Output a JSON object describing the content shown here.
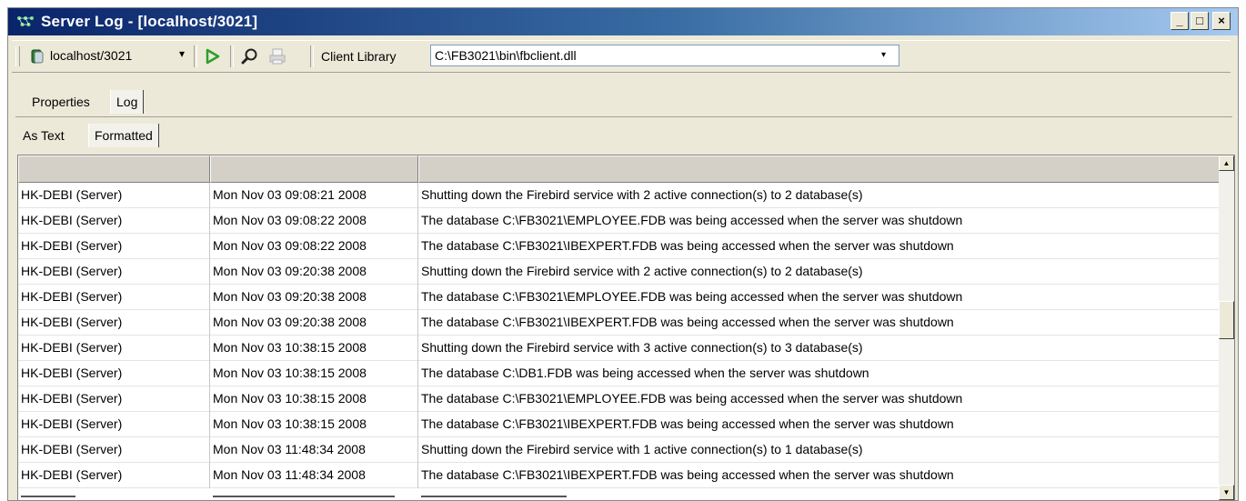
{
  "window": {
    "title": "Server Log - [localhost/3021]",
    "minimize_glyph": "_",
    "maximize_glyph": "□",
    "close_glyph": "×"
  },
  "toolbar": {
    "server_label": "localhost/3021",
    "client_library_label": "Client Library",
    "client_library_value": "C:\\FB3021\\bin\\fbclient.dll",
    "dropdown_arrow": "▾"
  },
  "tabs": [
    {
      "label": "Properties",
      "active": false
    },
    {
      "label": "Log",
      "active": true
    }
  ],
  "view_tabs": [
    {
      "label": "As Text",
      "active": false
    },
    {
      "label": "Formatted",
      "active": true
    }
  ],
  "columns": [
    "",
    "",
    ""
  ],
  "rows": [
    {
      "source": "HK-DEBI (Server)",
      "time": "Mon Nov 03 09:08:21 2008",
      "message": "Shutting down the Firebird service with 2 active connection(s) to 2 database(s)"
    },
    {
      "source": "HK-DEBI (Server)",
      "time": "Mon Nov 03 09:08:22 2008",
      "message": "The database C:\\FB3021\\EMPLOYEE.FDB was being accessed when the server was shutdown"
    },
    {
      "source": "HK-DEBI (Server)",
      "time": "Mon Nov 03 09:08:22 2008",
      "message": "The database C:\\FB3021\\IBEXPERT.FDB was being accessed when the server was shutdown"
    },
    {
      "source": "HK-DEBI (Server)",
      "time": "Mon Nov 03 09:20:38 2008",
      "message": "Shutting down the Firebird service with 2 active connection(s) to 2 database(s)"
    },
    {
      "source": "HK-DEBI (Server)",
      "time": "Mon Nov 03 09:20:38 2008",
      "message": "The database C:\\FB3021\\EMPLOYEE.FDB was being accessed when the server was shutdown"
    },
    {
      "source": "HK-DEBI (Server)",
      "time": "Mon Nov 03 09:20:38 2008",
      "message": "The database C:\\FB3021\\IBEXPERT.FDB was being accessed when the server was shutdown"
    },
    {
      "source": "HK-DEBI (Server)",
      "time": "Mon Nov 03 10:38:15 2008",
      "message": "Shutting down the Firebird service with 3 active connection(s) to 3 database(s)"
    },
    {
      "source": "HK-DEBI (Server)",
      "time": "Mon Nov 03 10:38:15 2008",
      "message": "The database C:\\DB1.FDB was being accessed when the server was shutdown"
    },
    {
      "source": "HK-DEBI (Server)",
      "time": "Mon Nov 03 10:38:15 2008",
      "message": "The database C:\\FB3021\\EMPLOYEE.FDB was being accessed when the server was shutdown"
    },
    {
      "source": "HK-DEBI (Server)",
      "time": "Mon Nov 03 10:38:15 2008",
      "message": "The database C:\\FB3021\\IBEXPERT.FDB was being accessed when the server was shutdown"
    },
    {
      "source": "HK-DEBI (Server)",
      "time": "Mon Nov 03 11:48:34 2008",
      "message": "Shutting down the Firebird service with 1 active connection(s) to 1 database(s)"
    },
    {
      "source": "HK-DEBI (Server)",
      "time": "Mon Nov 03 11:48:34 2008",
      "message": "The database C:\\FB3021\\IBEXPERT.FDB was being accessed when the server was shutdown"
    }
  ],
  "scrollbar": {
    "up_arrow": "▲",
    "down_arrow": "▼"
  },
  "colors": {
    "titlebar_start": "#0a246a",
    "titlebar_end": "#a6caf0",
    "window_bg": "#ece9d8",
    "run_green": "#2aa02a"
  }
}
